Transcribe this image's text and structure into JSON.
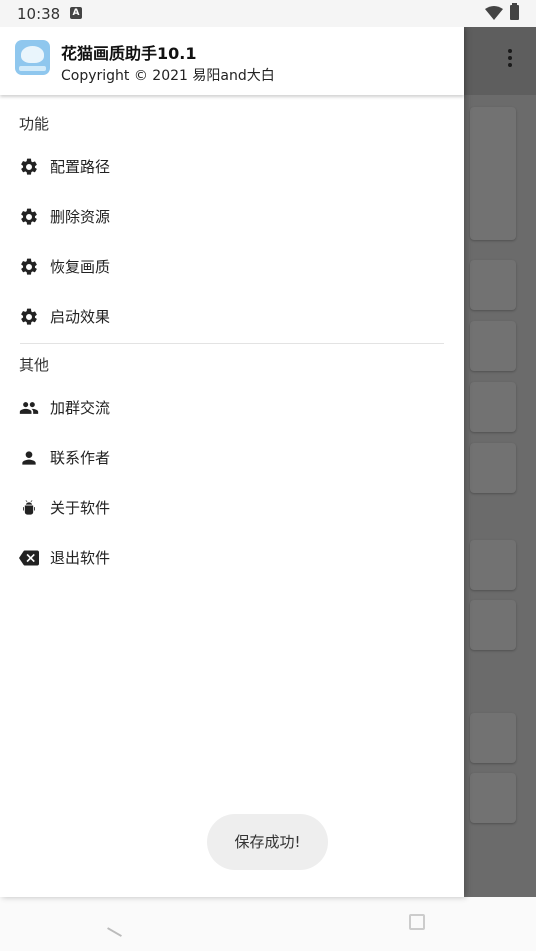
{
  "status_bar": {
    "time": "10:38",
    "notification_glyph": "A"
  },
  "header": {
    "title": "花猫画质助手10.1",
    "subtitle": "Copyright © 2021 易阳and大白"
  },
  "sections": [
    {
      "title": "功能",
      "items": [
        {
          "label": "配置路径",
          "icon": "gear-icon"
        },
        {
          "label": "删除资源",
          "icon": "gear-icon"
        },
        {
          "label": "恢复画质",
          "icon": "gear-icon"
        },
        {
          "label": "启动效果",
          "icon": "gear-icon"
        }
      ]
    },
    {
      "title": "其他",
      "items": [
        {
          "label": "加群交流",
          "icon": "group-icon"
        },
        {
          "label": "联系作者",
          "icon": "person-icon"
        },
        {
          "label": "关于软件",
          "icon": "android-icon"
        },
        {
          "label": "退出软件",
          "icon": "backspace-icon"
        }
      ]
    }
  ],
  "toast": {
    "text": "保存成功!"
  }
}
